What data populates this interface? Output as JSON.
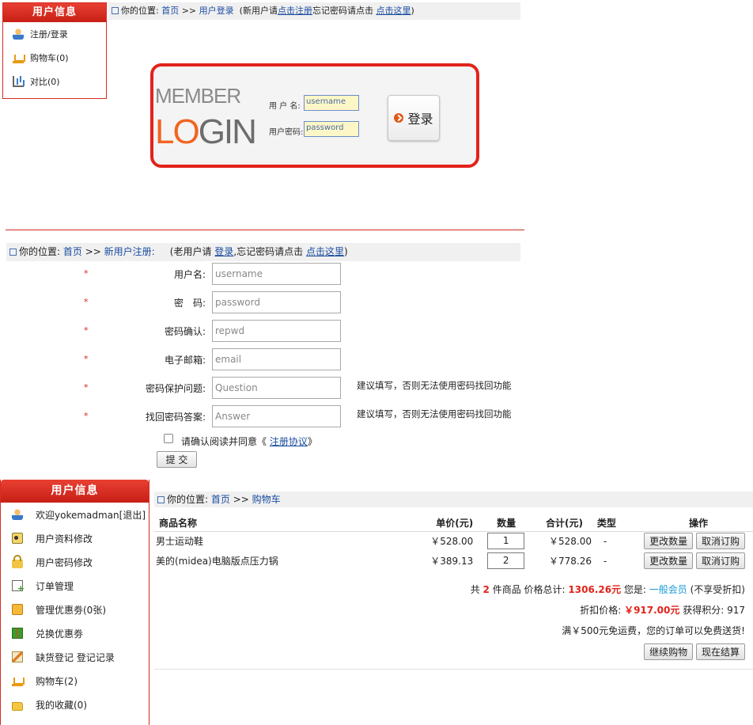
{
  "section1": {
    "sidebar": {
      "title": "用户信息",
      "items": [
        {
          "label": "注册/登录",
          "icon": "user-icon"
        },
        {
          "label": "购物车(0)",
          "icon": "cart-icon"
        },
        {
          "label": "对比(0)",
          "icon": "chart-icon"
        }
      ]
    },
    "breadcrumb": {
      "prefix": "你的位置:",
      "home": "首页",
      "sep": ">>",
      "current": "用户登录",
      "note_open": "(新用户请",
      "register_link": "点击注册",
      "note_mid": "忘记密码请点击",
      "recover_link": "点击这里",
      "note_close": ")"
    },
    "login": {
      "logo_member": "MEMBER",
      "logo_lo": "LO",
      "logo_gin": "GIN",
      "username_label": "用 户 名:",
      "username_value": "username",
      "password_label": "用户密码:",
      "password_value": "password",
      "button_label": "登录"
    }
  },
  "section2": {
    "breadcrumb": {
      "prefix": "你的位置:",
      "home": "首页",
      "sep": ">>",
      "current": "新用户注册:",
      "note_open": "(老用户请",
      "login_link": "登录",
      "note_mid": ",忘记密码请点击",
      "recover_link": "点击这里",
      "note_close": ")"
    },
    "required_mark": "*",
    "fields": [
      {
        "label": "用户名:",
        "value": "username",
        "hint": ""
      },
      {
        "label": "密　码:",
        "value": "password",
        "hint": ""
      },
      {
        "label": "密码确认:",
        "value": "repwd",
        "hint": ""
      },
      {
        "label": "电子邮箱:",
        "value": "email",
        "hint": ""
      },
      {
        "label": "密码保护问题:",
        "value": "Question",
        "hint": "建议填写，否则无法使用密码找回功能"
      },
      {
        "label": "找回密码答案:",
        "value": "Answer",
        "hint": "建议填写，否则无法使用密码找回功能"
      }
    ],
    "agree_text": "请确认阅读并同意《",
    "agree_link": "注册协议",
    "agree_close": "》",
    "submit_label": "提 交"
  },
  "section3": {
    "sidebar": {
      "title": "用户信息",
      "items": [
        {
          "label": "欢迎yokemadman[退出]",
          "icon": "user-icon"
        },
        {
          "label": "用户资料修改",
          "icon": "id-card-icon"
        },
        {
          "label": "用户密码修改",
          "icon": "lock-icon"
        },
        {
          "label": "订单管理",
          "icon": "order-add-icon"
        },
        {
          "label": "管理优惠劵(0张)",
          "icon": "coupon-icon"
        },
        {
          "label": "兑换优惠劵",
          "icon": "gift-icon"
        },
        {
          "label": "缺货登记 登记记录",
          "icon": "pen-icon"
        },
        {
          "label": "购物车(2)",
          "icon": "cart-icon"
        },
        {
          "label": "我的收藏(0)",
          "icon": "folder-icon"
        }
      ]
    },
    "breadcrumb": {
      "prefix": "你的位置:",
      "home": "首页",
      "sep": ">>",
      "current": "购物车"
    },
    "cart": {
      "headers": [
        "商品名称",
        "单价(元)",
        "数量",
        "合计(元)",
        "类型",
        "操作"
      ],
      "rows": [
        {
          "name": "男士运动鞋",
          "price": "￥528.00",
          "qty": "1",
          "total": "￥528.00",
          "type": "-",
          "update": "更改数量",
          "cancel": "取消订购"
        },
        {
          "name": "美的(midea)电脑版点压力锅",
          "price": "￥389.13",
          "qty": "2",
          "total": "￥778.26",
          "type": "-",
          "update": "更改数量",
          "cancel": "取消订购"
        }
      ]
    },
    "summary": {
      "count_pre": "共",
      "count": "2",
      "count_post": "件商品 价格总计:",
      "total": "1306.26元",
      "member_pre": "您是:",
      "member_level": "一般会员",
      "member_post": "(不享受折扣)",
      "discount_label": "折扣价格:",
      "discount_value": "￥917.00元",
      "points_label": "获得积分:",
      "points_value": "917",
      "shipping": "满￥500元免运费，您的订单可以免费送货!"
    },
    "continue_label": "继续购物",
    "checkout_label": "现在结算"
  },
  "colors": {
    "accent_red": "#e2231a",
    "link_blue": "#1a4ca0",
    "member_cyan": "#1a9bd7"
  }
}
